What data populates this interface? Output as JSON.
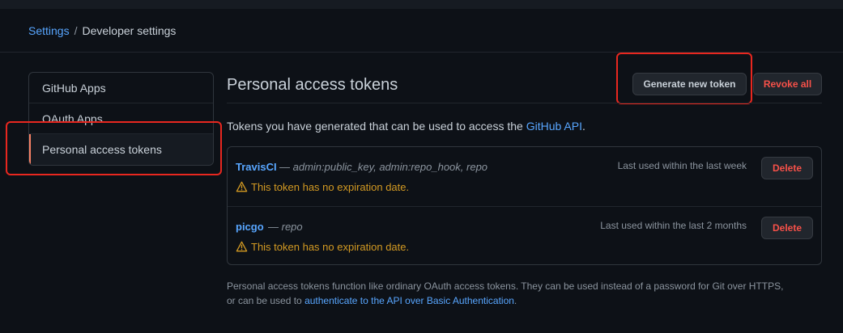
{
  "breadcrumb": {
    "settings": "Settings",
    "separator": "/",
    "current": "Developer settings"
  },
  "sidebar": {
    "items": [
      {
        "label": "GitHub Apps"
      },
      {
        "label": "OAuth Apps"
      },
      {
        "label": "Personal access tokens",
        "selected": true
      }
    ]
  },
  "main": {
    "title": "Personal access tokens",
    "generate_label": "Generate new token",
    "revoke_label": "Revoke all",
    "intro_prefix": "Tokens you have generated that can be used to access the ",
    "intro_link": "GitHub API",
    "intro_suffix": "."
  },
  "tokens": [
    {
      "name": "TravisCI",
      "dash": "—",
      "scopes": "admin:public_key, admin:repo_hook, repo",
      "last_used": "Last used within the last week",
      "warning": "This token has no expiration date.",
      "delete_label": "Delete"
    },
    {
      "name": "picgo",
      "dash": "—",
      "scopes": "repo",
      "last_used": "Last used within the last 2 months",
      "warning": "This token has no expiration date.",
      "delete_label": "Delete"
    }
  ],
  "footer": {
    "line1": "Personal access tokens function like ordinary OAuth access tokens. They can be used instead of a password for Git over HTTPS,",
    "line2_prefix": "or can be used to ",
    "line2_link": "authenticate to the API over Basic Authentication",
    "line2_suffix": "."
  },
  "colors": {
    "background": "#0d1117",
    "link": "#58a6ff",
    "danger": "#f85149",
    "warning": "#d29922",
    "selected_accent": "#f78166",
    "highlight": "#e8271f"
  }
}
